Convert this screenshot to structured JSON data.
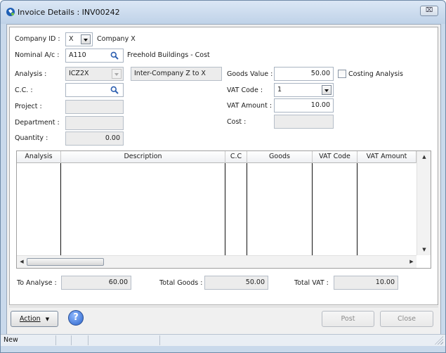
{
  "window": {
    "title": "Invoice Details : INV00242",
    "close_glyph": "⌧"
  },
  "form": {
    "company_id": {
      "label": "Company ID :",
      "value": "X",
      "name": "Company X"
    },
    "nominal": {
      "label": "Nominal A/c :",
      "value": "A110",
      "description": "Freehold Buildings - Cost"
    },
    "analysis": {
      "label": "Analysis :",
      "value": "ICZ2X",
      "description": "Inter-Company Z to X"
    },
    "cc": {
      "label": "C.C. :",
      "value": ""
    },
    "project": {
      "label": "Project :",
      "value": ""
    },
    "department": {
      "label": "Department :",
      "value": ""
    },
    "quantity": {
      "label": "Quantity :",
      "value": "0.00"
    },
    "goods_value": {
      "label": "Goods Value :",
      "value": "50.00"
    },
    "costing_analysis": {
      "label": "Costing Analysis",
      "checked": false
    },
    "vat_code": {
      "label": "VAT Code :",
      "value": "1"
    },
    "vat_amount": {
      "label": "VAT Amount :",
      "value": "10.00"
    },
    "cost": {
      "label": "Cost :",
      "value": ""
    }
  },
  "grid": {
    "columns": [
      "Analysis",
      "Description",
      "C.C",
      "Goods",
      "VAT Code",
      "VAT Amount"
    ],
    "rows": []
  },
  "totals": {
    "to_analyse": {
      "label": "To Analyse :",
      "value": "60.00"
    },
    "total_goods": {
      "label": "Total Goods :",
      "value": "50.00"
    },
    "total_vat": {
      "label": "Total VAT :",
      "value": "10.00"
    }
  },
  "buttons": {
    "action": "Action",
    "help": "?",
    "post": "Post",
    "close": "Close"
  },
  "status": {
    "mode": "New"
  },
  "icons": {
    "app": "sage-logo-icon",
    "lookup": "magnifier-icon",
    "help": "help-icon",
    "dropdown": "chevron-down-icon"
  },
  "colors": {
    "title_bar": "#c9d9eb",
    "readonly_field": "#ececec",
    "help_button": "#2b63c9"
  }
}
